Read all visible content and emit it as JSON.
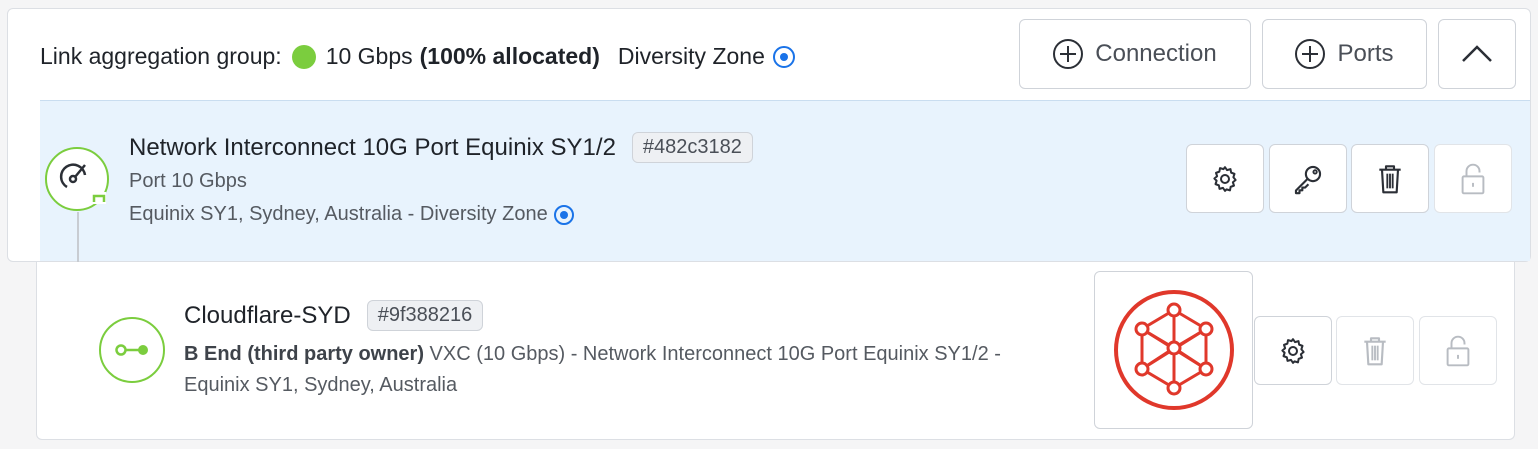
{
  "lag": {
    "prefix": "Link aggregation group:",
    "speed": "10 Gbps",
    "allocated": "(100% allocated)",
    "zone": "Diversity Zone",
    "status_color": "#7bcd3e"
  },
  "header_buttons": {
    "connection": "Connection",
    "ports": "Ports"
  },
  "port": {
    "name": "Network Interconnect 10G Port Equinix SY1/2",
    "id": "#482c3182",
    "type": "Port 10 Gbps",
    "location": "Equinix SY1, Sydney, Australia - Diversity Zone"
  },
  "connection": {
    "name": "Cloudflare-SYD",
    "id": "#9f388216",
    "owner": "B End (third party owner)",
    "details": " VXC (10 Gbps) - Network Interconnect 10G Port Equinix SY1/2 - Equinix SY1, Sydney, Australia"
  },
  "colors": {
    "accent_green": "#7bcd3e",
    "zone_blue": "#1a73e8",
    "selected_row": "#e8f3fd",
    "logo_red": "#e0382b"
  }
}
